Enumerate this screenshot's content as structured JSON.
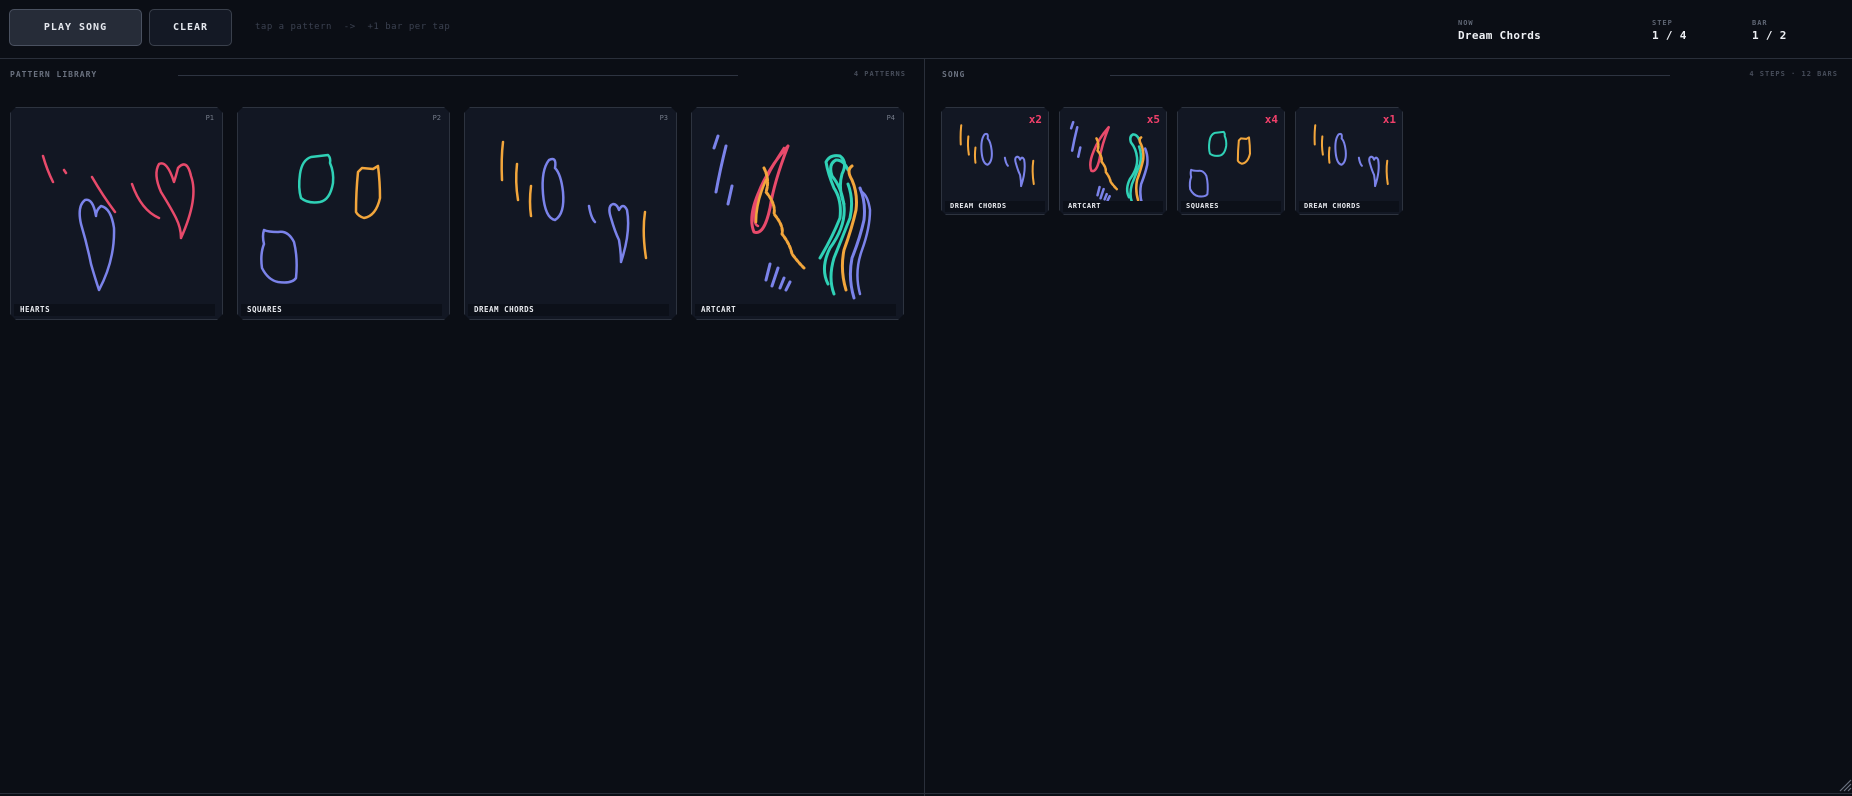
{
  "toolbar": {
    "play_label": "PLAY SONG",
    "clear_label": "CLEAR",
    "hint": "tap a pattern  ->  +1 bar per tap"
  },
  "status": {
    "now_label": "NOW",
    "now_value": "Dream Chords",
    "step_label": "STEP",
    "step_value": "1 / 4",
    "bar_label": "BAR",
    "bar_value": "1 / 2"
  },
  "library": {
    "title": "PATTERN LIBRARY",
    "count": "4 PATTERNS",
    "patterns": [
      {
        "id": "P1",
        "name": "HEARTS"
      },
      {
        "id": "P2",
        "name": "SQUARES"
      },
      {
        "id": "P3",
        "name": "DREAM CHORDS"
      },
      {
        "id": "P4",
        "name": "ARTCART"
      }
    ]
  },
  "song": {
    "title": "SONG",
    "count": "4 STEPS  ·  12 BARS",
    "steps": [
      {
        "name": "DREAM CHORDS",
        "repeat": "x2"
      },
      {
        "name": "ARTCART",
        "repeat": "x5"
      },
      {
        "name": "SQUARES",
        "repeat": "x4"
      },
      {
        "name": "DREAM CHORDS",
        "repeat": "x1"
      }
    ]
  },
  "colors": {
    "background": "#0b0e15",
    "red": "#e84a6b",
    "violet": "#7b83ea",
    "teal": "#2fd1b6",
    "orange": "#f2a63c",
    "repeat": "#f0406a"
  }
}
